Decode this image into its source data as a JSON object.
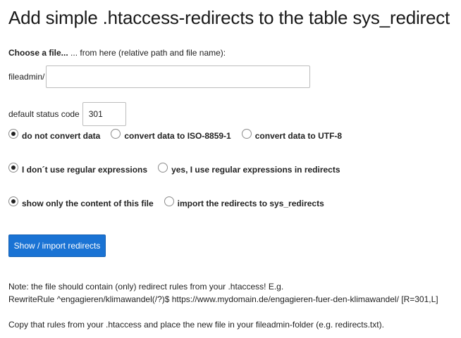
{
  "page": {
    "title": "Add simple .htaccess-redirects to the table sys_redirect"
  },
  "form": {
    "choose_bold": "Choose a file...",
    "choose_rest": " ... from here (relative path and file name):",
    "prefix": "fileadmin/",
    "file_value": "",
    "status_label": "default status code",
    "status_value": "301"
  },
  "charset": {
    "options": [
      {
        "label": "do not convert data",
        "checked": true
      },
      {
        "label": "convert data to ISO-8859-1",
        "checked": false
      },
      {
        "label": "convert data to UTF-8",
        "checked": false
      }
    ]
  },
  "regex": {
    "options": [
      {
        "label": "I don´t use regular expressions",
        "checked": true
      },
      {
        "label": "yes, I use regular expressions in redirects",
        "checked": false
      }
    ]
  },
  "mode": {
    "options": [
      {
        "label": "show only the content of this file",
        "checked": true
      },
      {
        "label": "import the redirects to sys_redirects",
        "checked": false
      }
    ]
  },
  "button": {
    "label": "Show / import redirects"
  },
  "notes": {
    "line1": "Note: the file should contain (only) redirect rules from your .htaccess! E.g.",
    "line2": "RewriteRule ^engagieren/klimawandel(/?)$ https://www.mydomain.de/engagieren-fuer-den-klimawandel/ [R=301,L]",
    "line3": "Copy that rules from your .htaccess and place the new file in your fileadmin-folder (e.g. redirects.txt)."
  },
  "colors": {
    "primary_button": "#1a73d4"
  }
}
